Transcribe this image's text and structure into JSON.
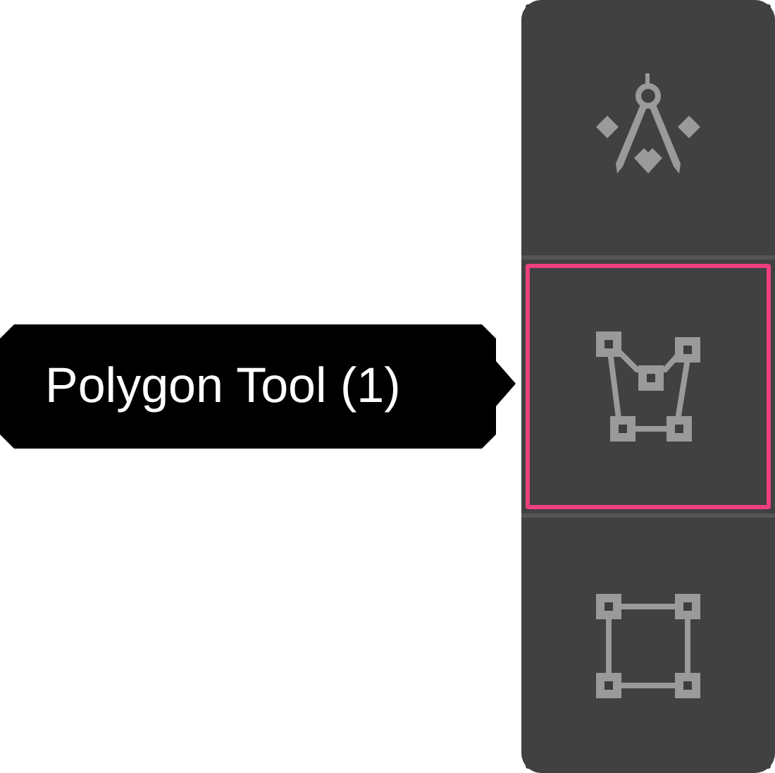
{
  "toolbar": {
    "tools": [
      {
        "kind": "compass",
        "selected": false
      },
      {
        "kind": "polygon",
        "selected": true
      },
      {
        "kind": "rectangle",
        "selected": false
      }
    ]
  },
  "tooltip": {
    "text": "Polygon Tool (1)"
  }
}
